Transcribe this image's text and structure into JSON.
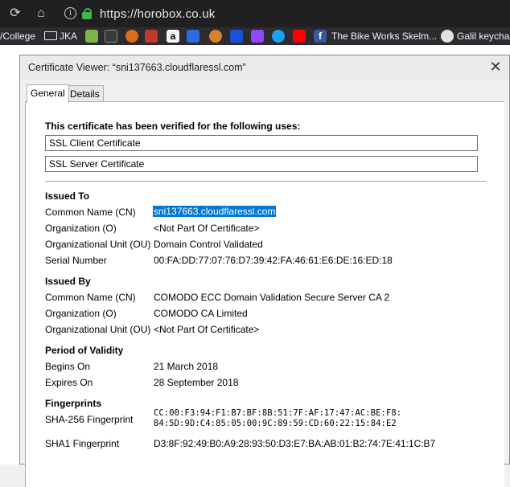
{
  "browser": {
    "url": "https://horobox.co.uk",
    "bookmarks": [
      {
        "label": "/College",
        "kind": "text"
      },
      {
        "label": "JKA",
        "kind": "folder"
      },
      {
        "label": "The Bike Works Skelm...",
        "kind": "favicon-text"
      },
      {
        "label": "Galil keychai",
        "kind": "favicon-text"
      }
    ],
    "colors": {
      "chrome_bg": "#202023",
      "bookmarks_bg": "#2b2b30",
      "lock": "#3fb54a",
      "selection": "#0078d7"
    }
  },
  "dialog": {
    "title": "Certificate Viewer: “sni137663.cloudflaressl.com”",
    "tabs": [
      {
        "label": "General",
        "active": true
      },
      {
        "label": "Details",
        "active": false
      }
    ],
    "verified_heading": "This certificate has been verified for the following uses:",
    "uses": [
      "SSL Client Certificate",
      "SSL Server Certificate"
    ],
    "issued_to": {
      "heading": "Issued To",
      "rows": [
        {
          "label": "Common Name (CN)",
          "value": "sni137663.cloudflaressl.com"
        },
        {
          "label": "Organization (O)",
          "value": "<Not Part Of Certificate>"
        },
        {
          "label": "Organizational Unit (OU)",
          "value": "Domain Control Validated"
        },
        {
          "label": "Serial Number",
          "value": "00:FA:DD:77:07:76:D7:39:42:FA:46:61:E6:DE:16:ED:18"
        }
      ]
    },
    "issued_by": {
      "heading": "Issued By",
      "rows": [
        {
          "label": "Common Name (CN)",
          "value": "COMODO ECC Domain Validation Secure Server CA 2"
        },
        {
          "label": "Organization (O)",
          "value": "COMODO CA Limited"
        },
        {
          "label": "Organizational Unit (OU)",
          "value": "<Not Part Of Certificate>"
        }
      ]
    },
    "validity": {
      "heading": "Period of Validity",
      "rows": [
        {
          "label": "Begins On",
          "value": "21 March 2018"
        },
        {
          "label": "Expires On",
          "value": "28 September 2018"
        }
      ]
    },
    "fingerprints": {
      "heading": "Fingerprints",
      "rows": [
        {
          "label": "SHA-256 Fingerprint",
          "value_line1": "CC:00:F3:94:F1:B7:BF:8B:51:7F:AF:17:47:AC:BE:F8:",
          "value_line2": "84:5D:9D:C4:85:05:00:9C:89:59:CD:60:22:15:84:E2"
        },
        {
          "label": "SHA1 Fingerprint",
          "value": "D3:8F:92:49:B0:A9:28:93:50:D3:E7:BA:AB:01:B2:74:7E:41:1C:B7"
        }
      ]
    }
  }
}
